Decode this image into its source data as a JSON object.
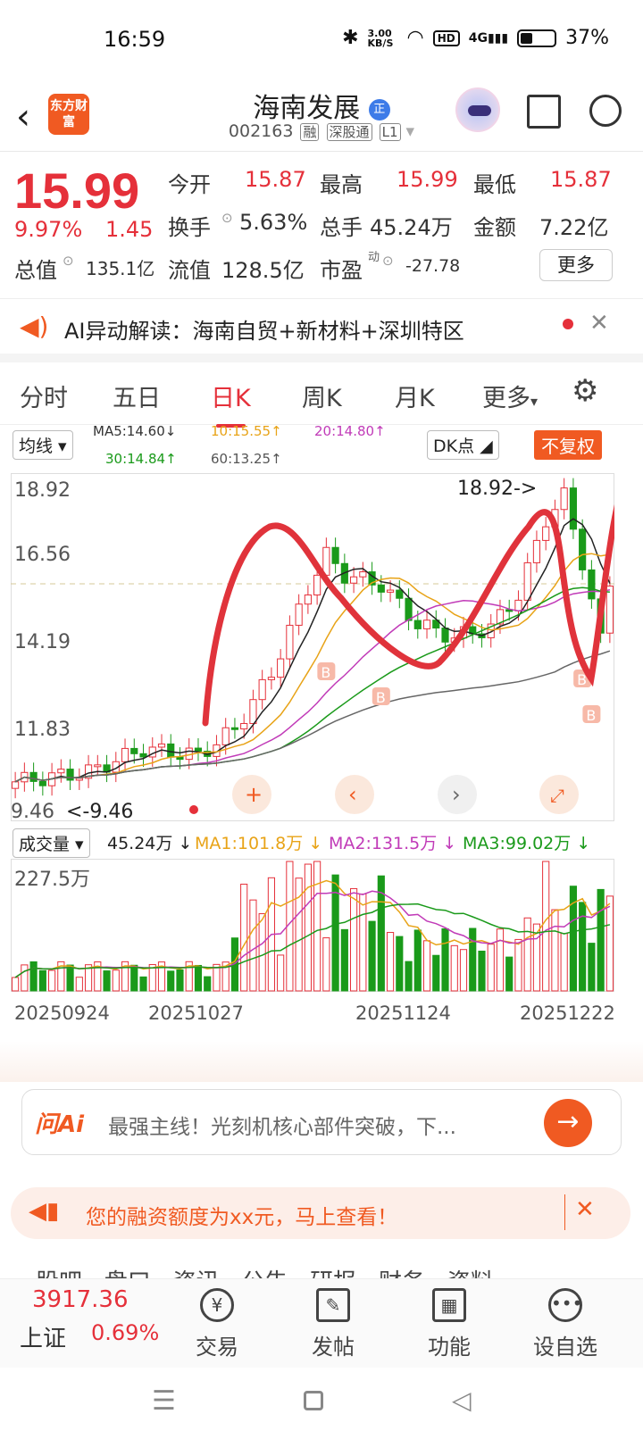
{
  "status_bar": {
    "time": "16:59",
    "net_speed": "3.00 KB/S",
    "hd": "HD",
    "signal": "4G",
    "battery": "37%"
  },
  "header": {
    "logo_text": "东方财富",
    "title": "海南发展",
    "title_badge": "正",
    "code": "002163",
    "tags": [
      "融",
      "深股通",
      "L1"
    ]
  },
  "quote": {
    "price": "15.99",
    "change_pct": "9.97%",
    "change": "1.45",
    "open_label": "今开",
    "open": "15.87",
    "high_label": "最高",
    "high": "15.99",
    "low_label": "最低",
    "low": "15.87",
    "turnover_label": "换手",
    "turnover": "5.63%",
    "volume_label": "总手",
    "volume": "45.24万",
    "amount_label": "金额",
    "amount": "7.22亿",
    "mktcap_label": "总值",
    "mktcap": "135.1亿",
    "float_label": "流值",
    "float": "128.5亿",
    "pe_label": "市盈",
    "pe_sup": "动",
    "pe": "-27.78",
    "more": "更多"
  },
  "ai_bar": {
    "text": "AI异动解读：海南自贸+新材料+深圳特区"
  },
  "tabs": [
    "分时",
    "五日",
    "日K",
    "周K",
    "月K",
    "更多"
  ],
  "chart_header": {
    "ma_select": "均线",
    "ma5": "MA5:14.60",
    "ma10": "10:15.55",
    "ma20": "20:14.80",
    "ma30": "30:14.84",
    "ma60": "60:13.25",
    "dk": "DK点",
    "fq": "不复权"
  },
  "chart_data": {
    "type": "candlestick",
    "y_ticks": [
      "18.92",
      "16.56",
      "14.19",
      "11.83",
      "9.46"
    ],
    "ylim": [
      9.46,
      18.92
    ],
    "high_annotation": "18.92->",
    "low_annotation": "<-9.46",
    "buy_marker": "B",
    "volume": {
      "label": "成交量",
      "value": "45.24万",
      "ma1": "MA1:101.8万",
      "ma2": "MA2:131.5万",
      "ma3": "MA3:99.02万",
      "y_max": "227.5万"
    },
    "x_labels": [
      "20250924",
      "20251027",
      "20251124",
      "20251222"
    ]
  },
  "ask": {
    "logo": "问Ai",
    "text": "最强主线！光刻机核心部件突破，下..."
  },
  "promo": {
    "text": "您的融资额度为xx元，马上查看！"
  },
  "bottom_nav": {
    "index_value": "3917.36",
    "index_name": "上证",
    "index_change": "0.69%",
    "items": [
      "交易",
      "发帖",
      "功能",
      "设自选"
    ],
    "peek_tabs": "股吧   盘口   资讯   公告   研报   财务   资料"
  },
  "colors": {
    "up": "#e5303a",
    "down": "#1a9a1a",
    "accent": "#f05a22"
  }
}
